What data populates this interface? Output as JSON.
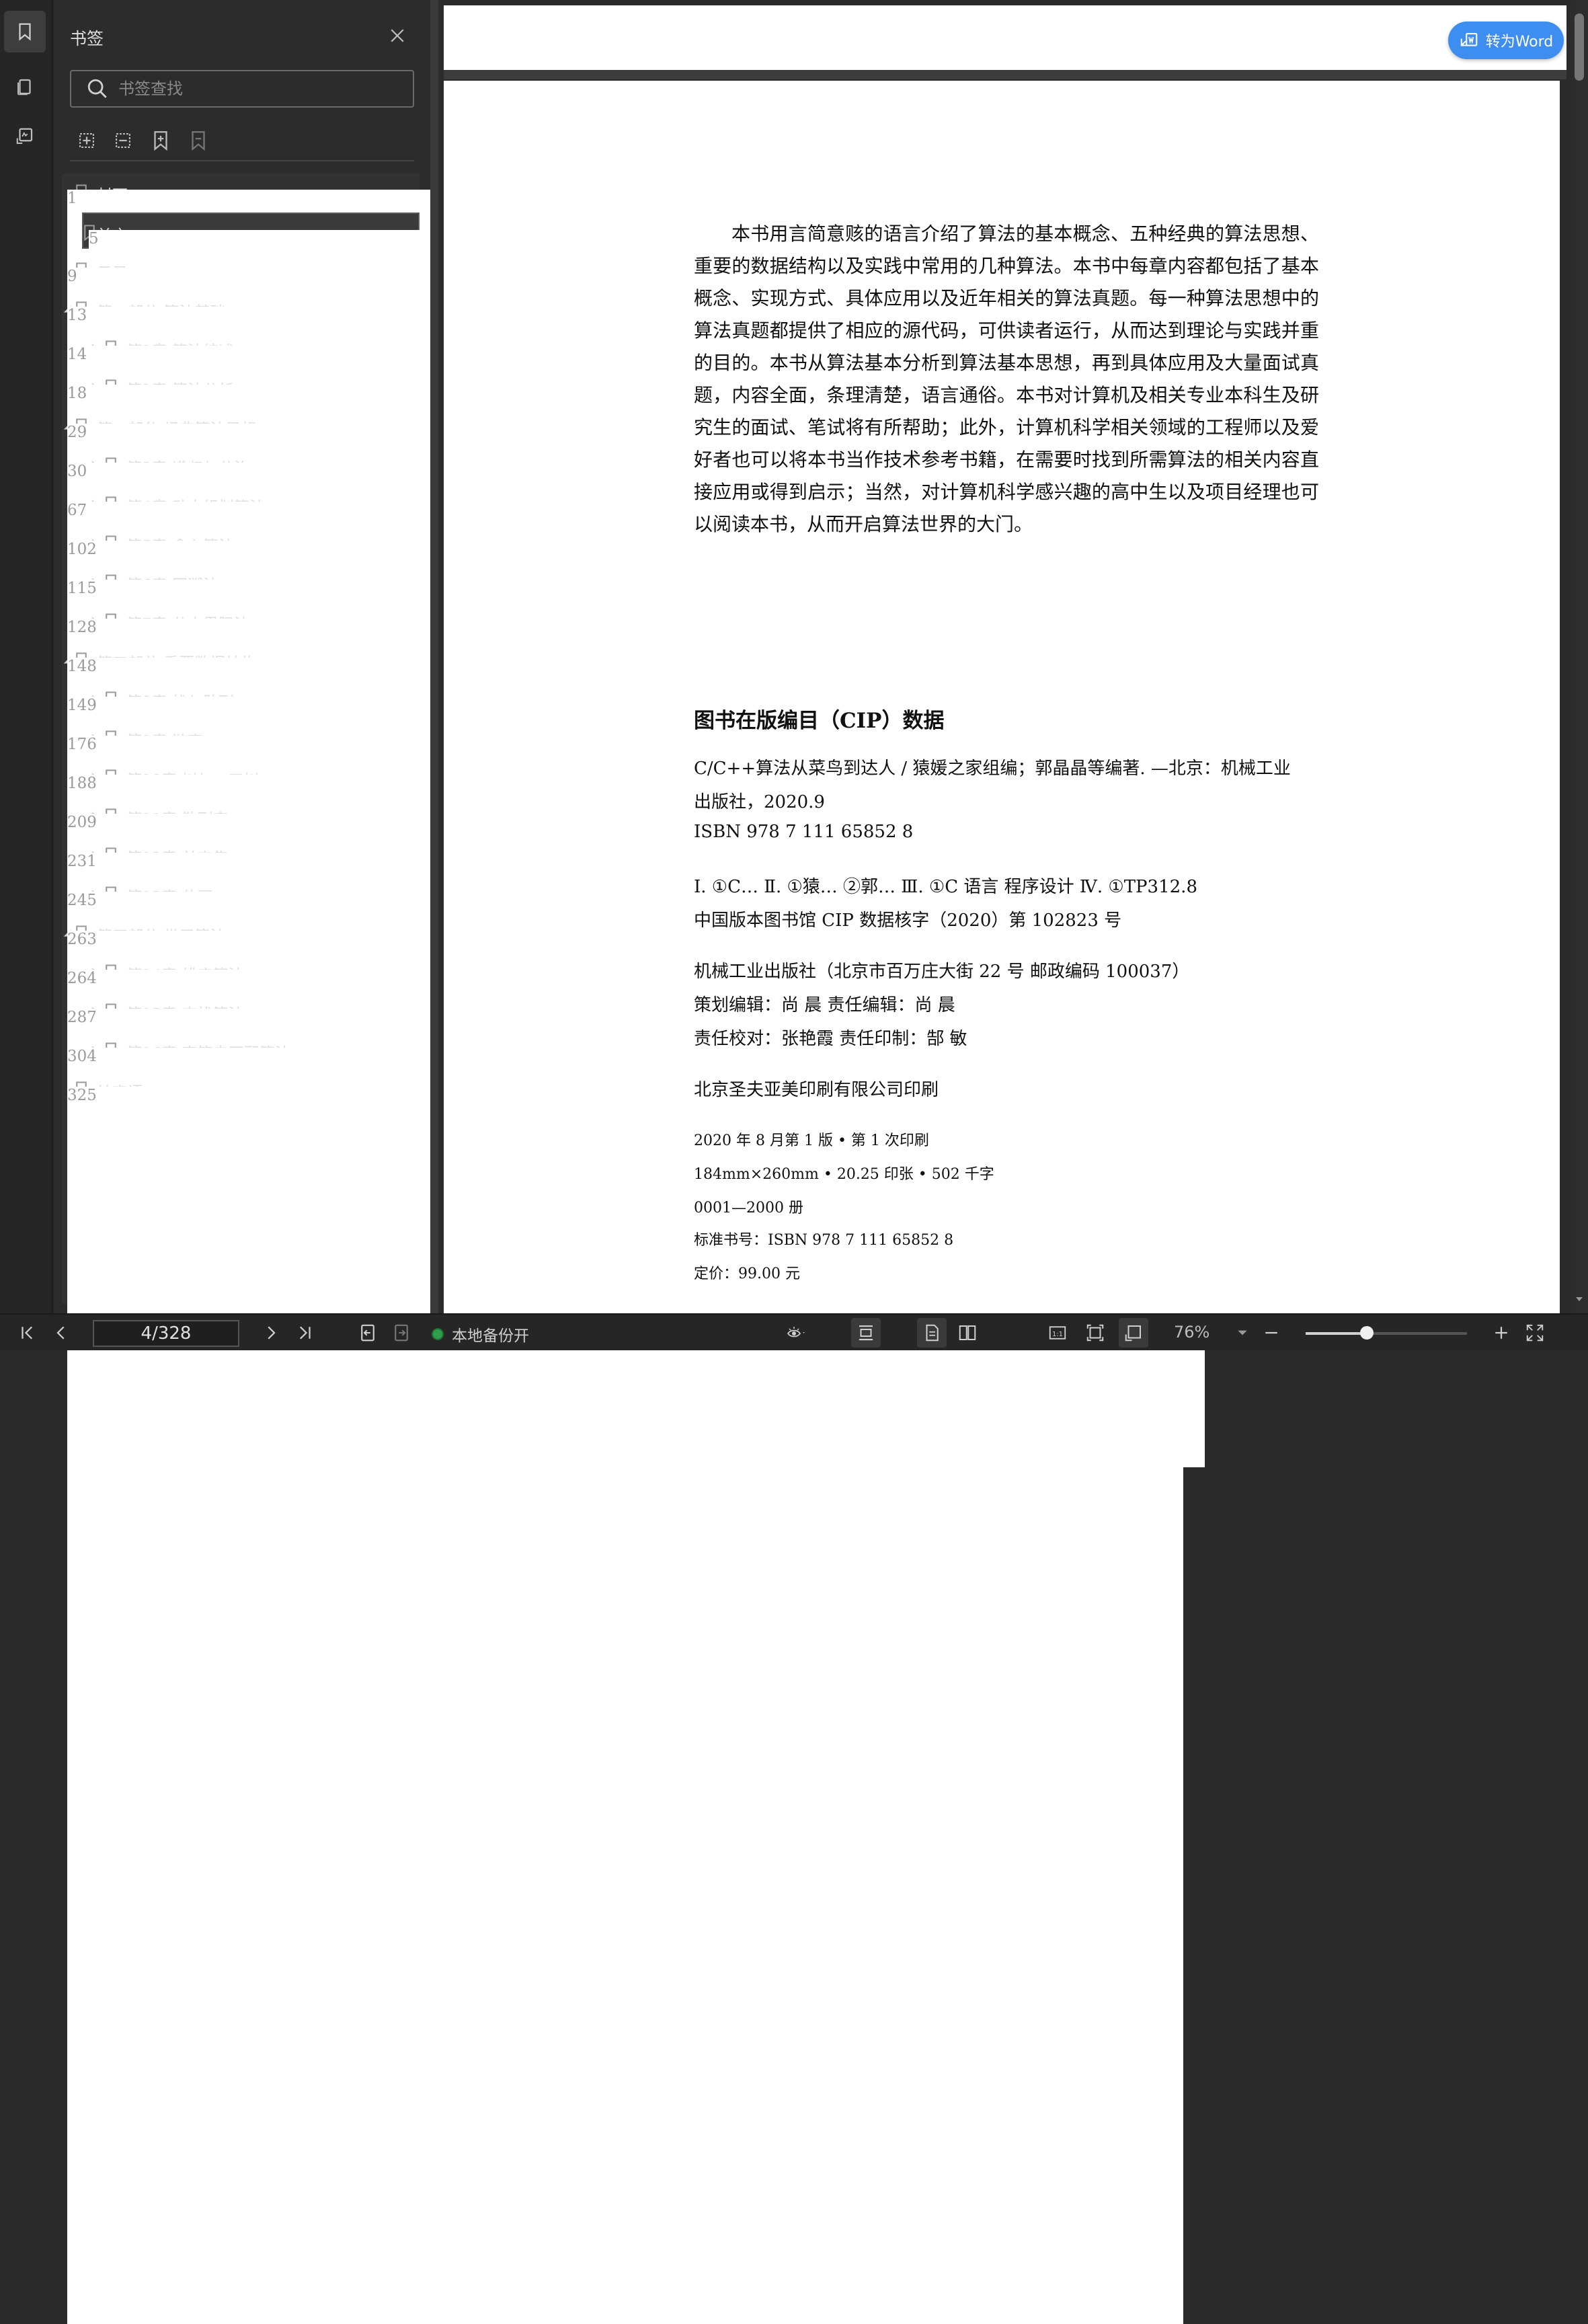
{
  "panel": {
    "title": "书签",
    "search_placeholder": "书签查找"
  },
  "bookmarks": [
    {
      "label": "封面",
      "page": "1",
      "level": 0,
      "expander": "none"
    },
    {
      "label": "前言",
      "page": "5",
      "level": 0,
      "expander": "none",
      "selected": true
    },
    {
      "label": "目录",
      "page": "9",
      "level": 0,
      "expander": "none"
    },
    {
      "label": "第一部分 算法基础",
      "page": "13",
      "level": 0,
      "expander": "expanded"
    },
    {
      "label": "第1章 算法综述",
      "page": "14",
      "level": 1,
      "expander": "collapsed"
    },
    {
      "label": "第2章 算法分析",
      "page": "18",
      "level": 1,
      "expander": "collapsed"
    },
    {
      "label": "第二部分 经典算法思想",
      "page": "29",
      "level": 0,
      "expander": "expanded"
    },
    {
      "label": "第3章 递归与分治",
      "page": "30",
      "level": 1,
      "expander": "collapsed"
    },
    {
      "label": "第4章 动态规划算法",
      "page": "67",
      "level": 1,
      "expander": "collapsed"
    },
    {
      "label": "第5章 贪心算法",
      "page": "102",
      "level": 1,
      "expander": "collapsed"
    },
    {
      "label": "第6章 回溯法",
      "page": "115",
      "level": 1,
      "expander": "collapsed"
    },
    {
      "label": "第7章 分支界限法",
      "page": "128",
      "level": 1,
      "expander": "collapsed"
    },
    {
      "label": "第三部分 重要数据结构",
      "page": "148",
      "level": 0,
      "expander": "expanded"
    },
    {
      "label": "第8章 栈与队列",
      "page": "149",
      "level": 1,
      "expander": "collapsed"
    },
    {
      "label": "第9章 链表",
      "page": "176",
      "level": 1,
      "expander": "collapsed"
    },
    {
      "label": "第10章 树与二叉树",
      "page": "188",
      "level": 1,
      "expander": "collapsed"
    },
    {
      "label": "第11章 散列表",
      "page": "209",
      "level": 1,
      "expander": "collapsed"
    },
    {
      "label": "第12章 并查集",
      "page": "231",
      "level": 1,
      "expander": "collapsed"
    },
    {
      "label": "第13章 位图",
      "page": "245",
      "level": 1,
      "expander": "collapsed"
    },
    {
      "label": "第四部分 常用算法",
      "page": "263",
      "level": 0,
      "expander": "expanded"
    },
    {
      "label": "第14章 排序算法",
      "page": "264",
      "level": 1,
      "expander": "collapsed"
    },
    {
      "label": "第15章 查找算法",
      "page": "287",
      "level": 1,
      "expander": "collapsed"
    },
    {
      "label": "第16章 字符串匹配算法",
      "page": "304",
      "level": 1,
      "expander": "collapsed"
    },
    {
      "label": "结束语",
      "page": "325",
      "level": 0,
      "expander": "none"
    }
  ],
  "document": {
    "convert_label": "转为Word",
    "abstract": "本书用言简意赅的语言介绍了算法的基本概念、五种经典的算法思想、重要的数据结构以及实践中常用的几种算法。本书中每章内容都包括了基本概念、实现方式、具体应用以及近年相关的算法真题。每一种算法思想中的算法真题都提供了相应的源代码，可供读者运行，从而达到理论与实践并重的目的。本书从算法基本分析到算法基本思想，再到具体应用及大量面试真题，内容全面，条理清楚，语言通俗。本书对计算机及相关专业本科生及研究生的面试、笔试将有所帮助；此外，计算机科学相关领域的工程师以及爱好者也可以将本书当作技术参考书籍，在需要时找到所需算法的相关内容直接应用或得到启示；当然，对计算机科学感兴趣的高中生以及项目经理也可以阅读本书，从而开启算法世界的大门。",
    "cip_title": "图书在版编目（CIP）数据",
    "cip_lines": [
      "C/C++算法从菜鸟到达人 / 猿媛之家组编；郭晶晶等编著. —北京：机械工业",
      "出版社，2020.9",
      "ISBN 978 7 111 65852 8",
      "Ⅰ. ①C…   Ⅱ. ①猿…  ②郭…   Ⅲ. ①C 语言    程序设计   Ⅳ. ①TP312.8",
      "中国版本图书馆 CIP 数据核字（2020）第 102823 号",
      "机械工业出版社（北京市百万庄大街 22 号   邮政编码 100037）",
      "策划编辑：尚   晨        责任编辑：尚   晨",
      "责任校对：张艳霞        责任印制：郜   敏",
      "北京圣夫亚美印刷有限公司印刷",
      "2020 年 8 月第 1 版 • 第 1 次印刷",
      "184mm×260mm • 20.25 印张 • 502 千字",
      "0001—2000 册",
      "标准书号：ISBN 978 7 111 65852 8",
      "定价：99.00 元"
    ]
  },
  "statusbar": {
    "page_indicator": "4/328",
    "backup_label": "本地备份开",
    "zoom": "76%",
    "zoom_fraction": 0.38
  },
  "colors": {
    "accent": "#3d8ef0",
    "backup_dot": "#2e9e4a"
  }
}
